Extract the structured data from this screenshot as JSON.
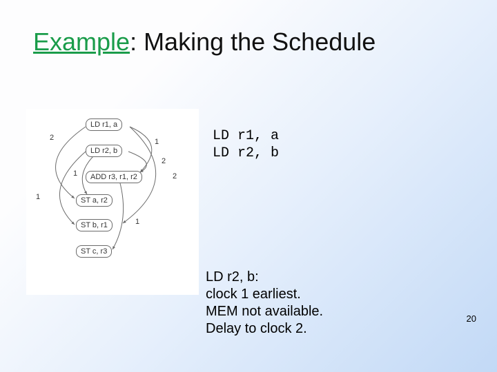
{
  "title": {
    "accent": "Example",
    "rest": ": Making the Schedule"
  },
  "code": {
    "line1": "LD r1, a",
    "line2": "LD r2, b"
  },
  "note": {
    "l1": "LD r2, b:",
    "l2": "clock 1 earliest.",
    "l3": "MEM  not available.",
    "l4": "Delay to clock 2."
  },
  "pagenum": "20",
  "diagram": {
    "n1": "LD r1, a",
    "n2": "LD r2, b",
    "n3": "ADD r3, r1, r2",
    "n4": "ST a, r2",
    "n5": "ST b, r1",
    "n6": "ST c, r3",
    "w_a": "2",
    "w_b": "1",
    "w_c": "2",
    "w_d": "2",
    "w_e": "1",
    "w_f": "1",
    "w_g": "1"
  }
}
